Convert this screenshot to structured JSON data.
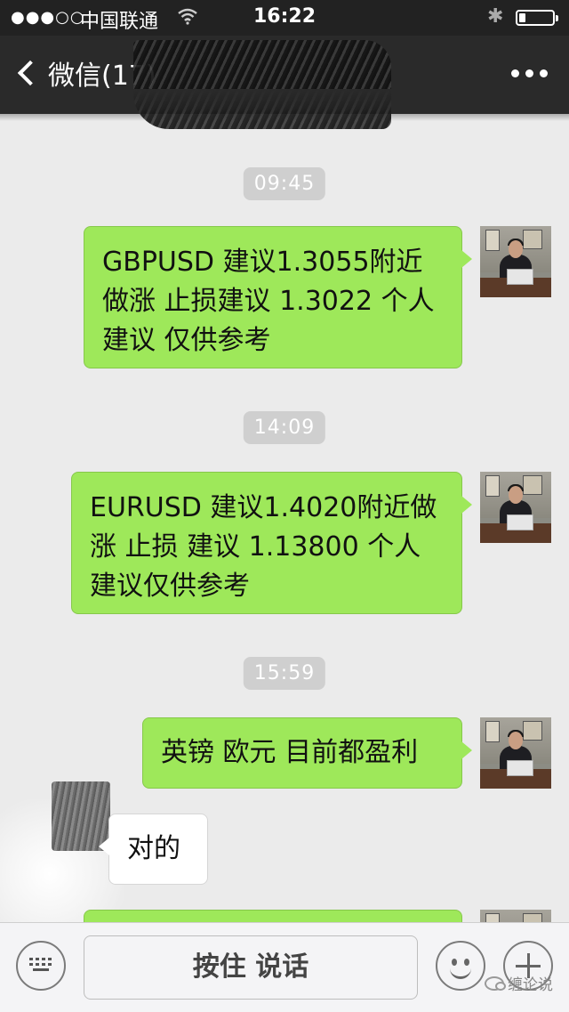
{
  "status_bar": {
    "signal": "●●●○○",
    "carrier": "中国联通",
    "time": "16:22",
    "battery_percent": 20
  },
  "nav": {
    "back_label": "微信(17)",
    "more_icon": "more-dots-icon"
  },
  "messages": [
    {
      "type": "timestamp",
      "text": "09:45"
    },
    {
      "type": "outgoing",
      "text": "GBPUSD  建议1.3055附近\n做涨 止损建议 1.3022 个人\n建议 仅供参考"
    },
    {
      "type": "timestamp",
      "text": "14:09"
    },
    {
      "type": "outgoing",
      "text": "EURUSD 建议1.4020附近做\n涨 止损 建议 1.13800  个人\n建议仅供参考"
    },
    {
      "type": "timestamp",
      "text": "15:59"
    },
    {
      "type": "outgoing",
      "text": "英镑 欧元 目前都盈利"
    },
    {
      "type": "incoming",
      "text": "对的"
    },
    {
      "type": "outgoing",
      "text": ""
    }
  ],
  "input_bar": {
    "hold_to_talk": "按住 说话",
    "keyboard_icon": "keyboard-icon",
    "emoji_icon": "emoji-icon",
    "plus_icon": "plus-icon"
  },
  "watermark": "缠论说",
  "colors": {
    "header_bg": "#2a2a2a",
    "chat_bg": "#ebebeb",
    "outgoing_bubble": "#9ee85a",
    "incoming_bubble": "#ffffff",
    "timestamp_bg": "#cfcfcf"
  }
}
